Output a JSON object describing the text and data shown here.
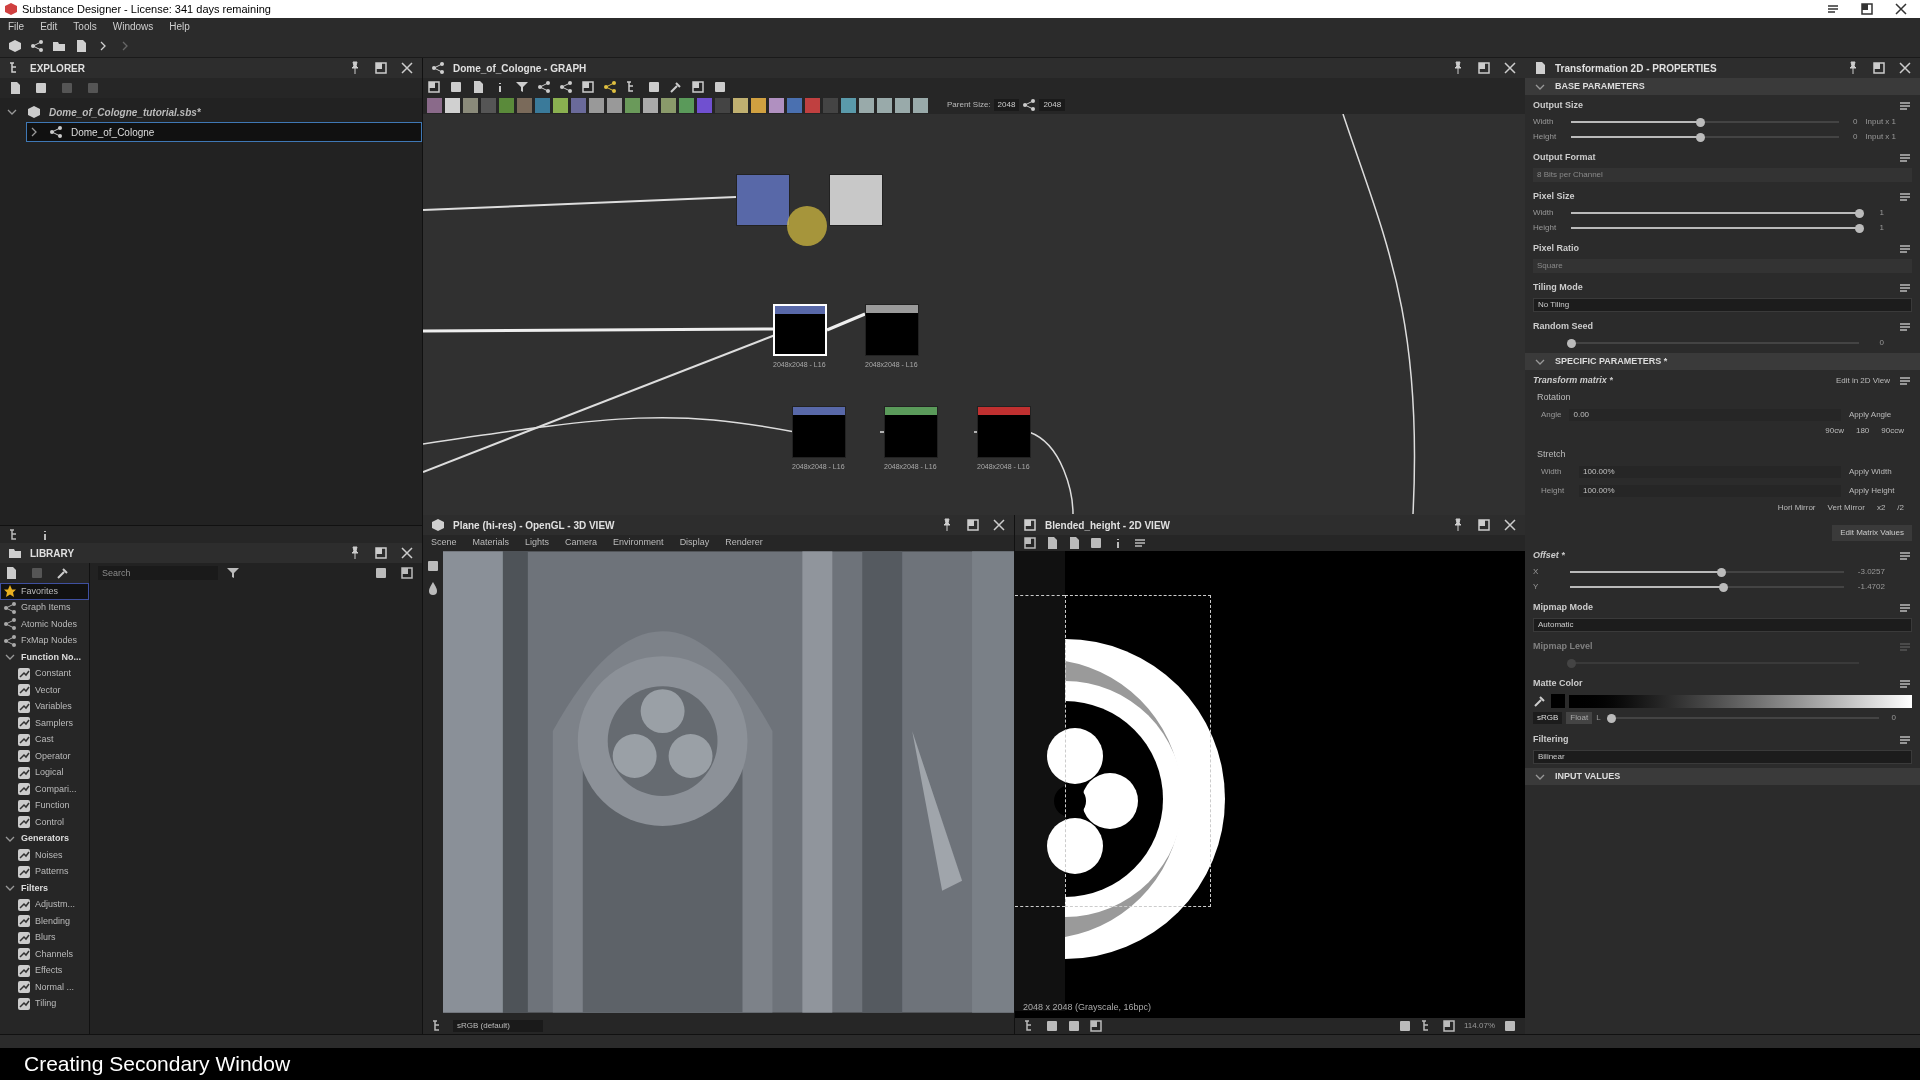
{
  "window": {
    "title": "Substance Designer - License: 341 days remaining"
  },
  "menu": [
    "File",
    "Edit",
    "Tools",
    "Windows",
    "Help"
  ],
  "explorer": {
    "title": "EXPLORER",
    "tree": [
      {
        "label": "Dome_of_Cologne_tutorial.sbs*",
        "expanded": true,
        "selected": false,
        "children": [
          {
            "label": "Dome_of_Cologne",
            "expanded": false,
            "selected": true
          }
        ]
      }
    ]
  },
  "library": {
    "title": "LIBRARY",
    "search": {
      "placeholder": "Search"
    },
    "tree": [
      {
        "label": "Favorites",
        "selected": true
      },
      {
        "label": "Graph Items",
        "selected": false
      },
      {
        "label": "Atomic Nodes",
        "selected": false
      },
      {
        "label": "FxMap Nodes",
        "selected": false
      },
      {
        "label": "Function No...",
        "selected": false,
        "expanded": true,
        "children": [
          {
            "label": "Constant",
            "selected": false
          },
          {
            "label": "Vector",
            "selected": false
          },
          {
            "label": "Variables",
            "selected": false
          },
          {
            "label": "Samplers",
            "selected": false
          },
          {
            "label": "Cast",
            "selected": false
          },
          {
            "label": "Operator",
            "selected": false
          },
          {
            "label": "Logical",
            "selected": false
          },
          {
            "label": "Compari...",
            "selected": false
          },
          {
            "label": "Function",
            "selected": false
          },
          {
            "label": "Control",
            "selected": false
          }
        ]
      },
      {
        "label": "Generators",
        "selected": false,
        "expanded": true,
        "children": [
          {
            "label": "Noises",
            "selected": false
          },
          {
            "label": "Patterns",
            "selected": false
          }
        ]
      },
      {
        "label": "Filters",
        "selected": false,
        "expanded": true,
        "children": [
          {
            "label": "Adjustm...",
            "selected": false
          },
          {
            "label": "Blending",
            "selected": false
          },
          {
            "label": "Blurs",
            "selected": false
          },
          {
            "label": "Channels",
            "selected": false
          },
          {
            "label": "Effects",
            "selected": false
          },
          {
            "label": "Normal ...",
            "selected": false
          },
          {
            "label": "Tiling",
            "selected": false
          }
        ]
      }
    ]
  },
  "graph": {
    "title": "Dome_of_Cologne - GRAPH",
    "parent_size_label": "Parent Size:",
    "parent_size": "2048",
    "linked_size": "2048",
    "nodes": [
      {
        "color": "#5868a8",
        "selected": false
      },
      {
        "color": "#c8c8c8",
        "selected": false
      },
      {
        "color": "#5868a8",
        "selected": true,
        "caption": "2048x2048 - L16"
      },
      {
        "color": "#9a9a9a",
        "selected": false,
        "caption": "2048x2048 - L16"
      },
      {
        "color": "#5868a8",
        "selected": false,
        "caption": "2048x2048 - L16"
      },
      {
        "color": "#5a9a5a",
        "selected": false,
        "caption": "2048x2048 - L16"
      },
      {
        "color": "#c03030",
        "selected": false,
        "caption": "2048x2048 - L16"
      }
    ]
  },
  "view3d": {
    "title": "Plane (hi-res) - OpenGL - 3D VIEW",
    "menu": [
      "Scene",
      "Materials",
      "Lights",
      "Camera",
      "Environment",
      "Display",
      "Renderer"
    ],
    "colorspace": "sRGB (default)"
  },
  "view2d": {
    "title": "Blended_height - 2D VIEW",
    "info": "2048 x 2048 (Grayscale, 16bpc)",
    "zoom": "114.07%"
  },
  "properties": {
    "title": "Transformation 2D - PROPERTIES",
    "base": {
      "title": "BASE PARAMETERS",
      "params": [
        {
          "kind": "sliders",
          "label": "Output Size",
          "disabled": false,
          "rows": [
            {
              "name": "Width",
              "level": 0.48,
              "value": "0",
              "suffix": "Input x 1"
            },
            {
              "name": "Height",
              "level": 0.48,
              "value": "0",
              "suffix": "Input x 1"
            }
          ]
        },
        {
          "kind": "dropdown",
          "label": "Output Format",
          "value": "8 Bits per Channel",
          "disabled": true
        },
        {
          "kind": "sliders",
          "label": "Pixel Size",
          "disabled": false,
          "rows": [
            {
              "name": "Width",
              "level": 1,
              "value": "1"
            },
            {
              "name": "Height",
              "level": 1,
              "value": "1"
            }
          ]
        },
        {
          "kind": "dropdown",
          "label": "Pixel Ratio",
          "value": "Square",
          "disabled": true
        },
        {
          "kind": "dropdown",
          "label": "Tiling Mode",
          "value": "No Tiling",
          "disabled": false
        },
        {
          "kind": "sliders",
          "label": "Random Seed",
          "disabled": false,
          "rows": [
            {
              "level": 0,
              "value": "0"
            }
          ]
        }
      ]
    },
    "specific": {
      "title": "SPECIFIC PARAMETERS *",
      "params": [
        {
          "kind": "matrix",
          "label": "Transform matrix *",
          "link": "Edit in 2D View",
          "rotation": "Rotation",
          "angle_label": "Angle",
          "angle": "0.00",
          "apply_angle": "Apply Angle",
          "quick": [
            "90cw",
            "180",
            "90ccw"
          ],
          "stretch": "Stretch",
          "stretch_rows": [
            {
              "name": "Width",
              "value": "100.00%",
              "apply": "Apply Width"
            },
            {
              "name": "Height",
              "value": "100.00%",
              "apply": "Apply Height"
            }
          ],
          "mirror": [
            "Hori Mirror",
            "Vert Mirror",
            "x2",
            "/2"
          ],
          "edit_values": "Edit Matrix Values"
        },
        {
          "kind": "sliders",
          "label": "Offset *",
          "disabled": false,
          "rows": [
            {
              "name": "X",
              "level": 0.55,
              "value": "-3.0257"
            },
            {
              "name": "Y",
              "level": 0.56,
              "value": "-1.4702"
            }
          ]
        },
        {
          "kind": "dropdown",
          "label": "Mipmap Mode",
          "value": "Automatic",
          "disabled": false
        },
        {
          "kind": "sliders",
          "label": "Mipmap Level",
          "disabled": true,
          "rows": [
            {
              "level": 0
            }
          ]
        },
        {
          "kind": "color",
          "label": "Matte Color",
          "color": "#000000",
          "modes": [
            {
              "label": "sRGB",
              "selected": true
            },
            {
              "label": "Float",
              "selected": false
            }
          ],
          "channel": "L",
          "level": 0,
          "value": "0"
        },
        {
          "kind": "dropdown",
          "label": "Filtering",
          "value": "Bilinear",
          "disabled": false
        }
      ]
    },
    "input_values": {
      "title": "INPUT VALUES"
    }
  },
  "caption": "Creating Secondary Window"
}
